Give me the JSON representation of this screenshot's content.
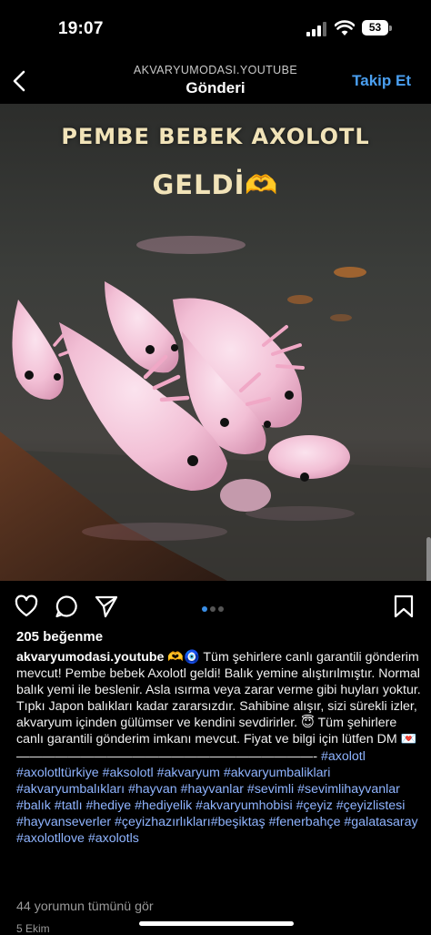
{
  "status_bar": {
    "time": "19:07",
    "battery": "53"
  },
  "header": {
    "account": "AKVARYUMODASI.YOUTUBE",
    "title": "Gönderi",
    "follow_label": "Takip Et"
  },
  "image": {
    "title": "PEMBE BEBEK AXOLOTL",
    "subtitle": "GELDİ🫶"
  },
  "actions": [
    "heart-icon",
    "comment-icon",
    "share-icon",
    "bookmark-icon"
  ],
  "carousel": {
    "total": 3,
    "active": 1
  },
  "post": {
    "likes": "205 beğenme",
    "username": "akvaryumodasi.youtube",
    "caption": " 🫶🧿 Tüm şehirlere canlı garantili gönderim mevcut! Pembe bebek Axolotl geldi! Balık yemine alıştırılmıştır. Normal balık yemi ile beslenir. Asla ısırma veya zarar verme gibi huyları yoktur. Tıpkı Japon balıkları kadar zararsızdır. Sahibine alışır, sizi sürekli izler, akvaryum içinden gülümser ve kendini sevdirirler. 😇 Tüm şehirlere canlı garantili gönderim imkanı mevcut. Fiyat ve bilgi için lütfen DM 💌",
    "divider": "———————————————————————-",
    "hashtags": " #axolotl #axolotltürkiye #aksolotl #akvaryum #akvaryumbaliklari #akvaryumbalıkları #hayvan #hayvanlar #sevimli #sevimlihayvanlar #balık #tatlı #hediye #hediyelik #akvaryumhobisi #çeyiz #çeyizlistesi #hayvanseverler #çeyizhazırlıkları#beşiktaş #fenerbahçe #galatasaray #axolotllove #axolotls",
    "comments_link": "44 yorumun tümünü gör",
    "date": "5 Ekim"
  },
  "colors": {
    "accent": "#4a9ff0",
    "hashtag": "#8fb4ff",
    "axolotl": "#f5c9dc"
  }
}
